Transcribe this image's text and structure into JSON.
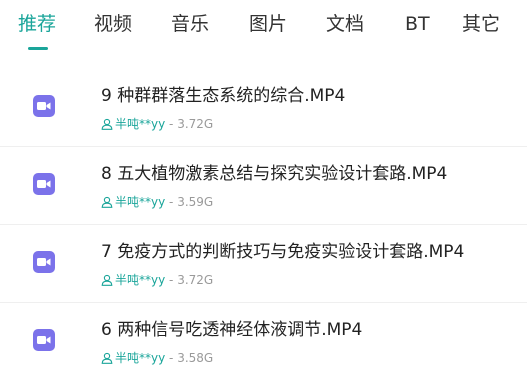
{
  "tabs": [
    {
      "label": "推荐",
      "active": true
    },
    {
      "label": "视频",
      "active": false
    },
    {
      "label": "音乐",
      "active": false
    },
    {
      "label": "图片",
      "active": false
    },
    {
      "label": "文档",
      "active": false
    },
    {
      "label": "BT",
      "active": false
    },
    {
      "label": "其它",
      "active": false
    }
  ],
  "colors": {
    "accent": "#1aa59a",
    "video_icon_bg": "#7b72ea",
    "text_primary": "#222222",
    "text_secondary": "#9a9a9a"
  },
  "files": [
    {
      "title": "9 种群群落生态系统的综合.MP4",
      "user": "半吨**yy",
      "size": "3.72G",
      "icon": "video-file-icon"
    },
    {
      "title": "8 五大植物激素总结与探究实验设计套路.MP4",
      "user": "半吨**yy",
      "size": "3.59G",
      "icon": "video-file-icon"
    },
    {
      "title": "7 免疫方式的判断技巧与免疫实验设计套路.MP4",
      "user": "半吨**yy",
      "size": "3.72G",
      "icon": "video-file-icon"
    },
    {
      "title": "6 两种信号吃透神经体液调节.MP4",
      "user": "半吨**yy",
      "size": "3.58G",
      "icon": "video-file-icon"
    }
  ],
  "separator": " - "
}
